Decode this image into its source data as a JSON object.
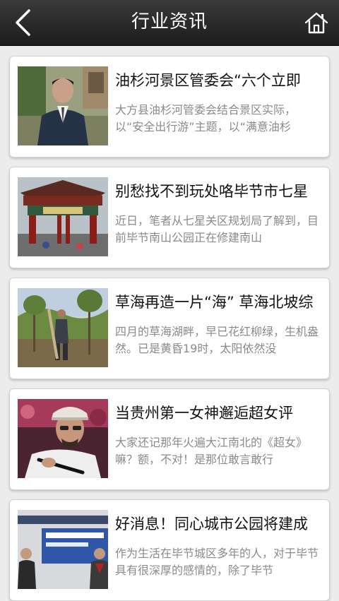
{
  "header": {
    "title": "行业资讯",
    "back_icon": "back-arrow-icon",
    "home_icon": "home-icon"
  },
  "articles": [
    {
      "title": "油杉河景区管委会“六个立即",
      "summary": "大方县油杉河管委会结合景区实际，以“安全出行游”主题，以“满意油杉",
      "image": "portrait of man in dark suit"
    },
    {
      "title": "别愁找不到玩处咯毕节市七星",
      "summary": "近日，笔者从七星关区规划局了解到，目前毕节南山公园正在修建南山",
      "image": "traditional gate archway"
    },
    {
      "title": "草海再造一片“海” 草海北坡综",
      "summary": "四月的草海湖畔，早已花红柳绿，生机盎然。已是黄昏19时，太阳依然没",
      "image": "worker planting trees"
    },
    {
      "title": "当贵州第一女神邂逅超女评",
      "summary": "大家还记那年火遍大江南北的《超女》嘛？额，不对！是那位敢言敢行",
      "image": "man in white hat with microphone"
    },
    {
      "title": "好消息！同心城市公园将建成",
      "summary": "作为生活在毕节城区多年的人，对于毕节具有很深厚的感情的，除了毕节",
      "image": "people at event banner"
    }
  ]
}
